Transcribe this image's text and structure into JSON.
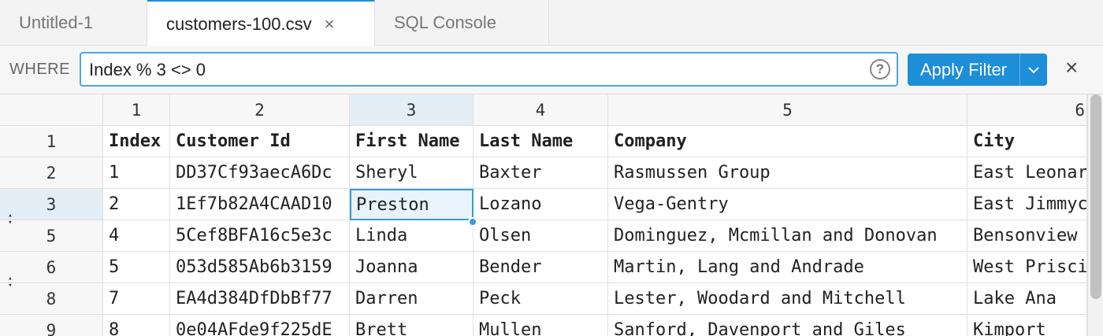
{
  "tabs": [
    {
      "label": "Untitled-1"
    },
    {
      "label": "customers-100.csv",
      "close": "×"
    },
    {
      "label": "SQL Console"
    }
  ],
  "filter": {
    "where_label": "WHERE",
    "query": "Index % 3 <> 0",
    "help": "?",
    "apply_label": "Apply Filter",
    "close": "×"
  },
  "grid": {
    "column_numbers": [
      "1",
      "2",
      "3",
      "4",
      "5",
      "6"
    ],
    "row_numbers": [
      "1",
      "2",
      "3",
      "5",
      "6",
      "8",
      "9"
    ],
    "header_row": [
      "Index",
      "Customer Id",
      "First Name",
      "Last Name",
      "Company",
      "City"
    ],
    "rows": [
      [
        "1",
        "DD37Cf93aecA6Dc",
        "Sheryl",
        "Baxter",
        "Rasmussen Group",
        "East Leonard"
      ],
      [
        "2",
        "1Ef7b82A4CAAD10",
        "Preston",
        "Lozano",
        "Vega-Gentry",
        "East Jimmychester"
      ],
      [
        "4",
        "5Cef8BFA16c5e3c",
        "Linda",
        "Olsen",
        "Dominguez, Mcmillan and Donovan",
        "Bensonview"
      ],
      [
        "5",
        "053d585Ab6b3159",
        "Joanna",
        "Bender",
        "Martin, Lang and Andrade",
        "West Priscilla"
      ],
      [
        "7",
        "EA4d384DfDbBf77",
        "Darren",
        "Peck",
        "Lester, Woodard and Mitchell",
        "Lake Ana"
      ],
      [
        "8",
        "0e04AFde9f225dE",
        "Brett",
        "Mullen",
        "Sanford, Davenport and Giles",
        "Kimport"
      ]
    ],
    "selected": {
      "column": "3",
      "row_number": "3"
    }
  },
  "colors": {
    "accent": "#1e8ed8",
    "selection": "#e3eef7"
  }
}
